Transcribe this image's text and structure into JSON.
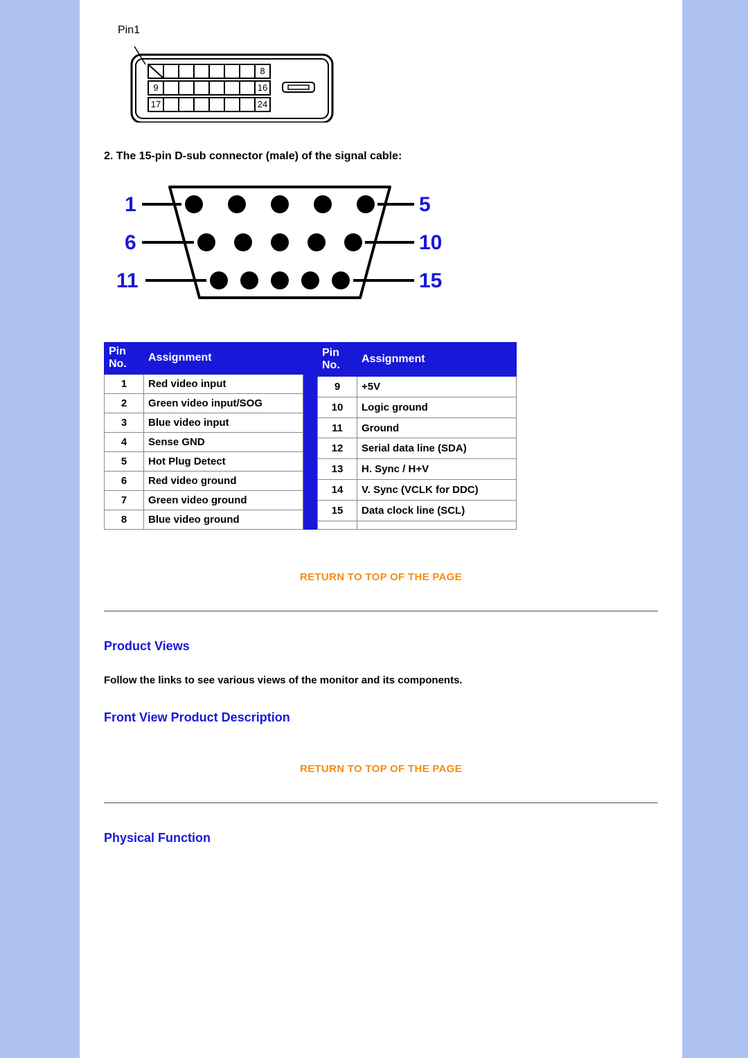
{
  "dvi": {
    "pin1_label": "Pin1",
    "cells_row1_last": "8",
    "cells_row2_first": "9",
    "cells_row2_last": "16",
    "cells_row3_first": "17",
    "cells_row3_last": "24"
  },
  "dsub": {
    "caption": "2. The 15-pin D-sub connector (male) of the signal cable:",
    "labels_left": [
      "1",
      "6",
      "11"
    ],
    "labels_right": [
      "5",
      "10",
      "15"
    ]
  },
  "pin_table": {
    "header_pin": "Pin No.",
    "header_assign": "Assignment",
    "left": [
      {
        "pin": "1",
        "assign": "Red video input"
      },
      {
        "pin": "2",
        "assign": "Green video input/SOG"
      },
      {
        "pin": "3",
        "assign": "Blue video input"
      },
      {
        "pin": "4",
        "assign": "Sense GND"
      },
      {
        "pin": "5",
        "assign": "Hot Plug Detect"
      },
      {
        "pin": "6",
        "assign": "Red video ground"
      },
      {
        "pin": "7",
        "assign": "Green video ground"
      },
      {
        "pin": "8",
        "assign": "Blue video ground"
      }
    ],
    "right": [
      {
        "pin": "9",
        "assign": "+5V"
      },
      {
        "pin": "10",
        "assign": "Logic ground"
      },
      {
        "pin": "11",
        "assign": "Ground"
      },
      {
        "pin": "12",
        "assign": "Serial data line (SDA)"
      },
      {
        "pin": "13",
        "assign": "H. Sync / H+V"
      },
      {
        "pin": "14",
        "assign": "V. Sync (VCLK for DDC)"
      },
      {
        "pin": "15",
        "assign": "Data clock line (SCL)"
      },
      {
        "pin": "",
        "assign": ""
      }
    ]
  },
  "links": {
    "return_top": "RETURN TO TOP OF THE PAGE",
    "product_views": "Product Views",
    "product_views_desc": "Follow the links to see various views of the monitor and its components.",
    "front_view": "Front View Product Description",
    "physical_function": "Physical Function"
  }
}
